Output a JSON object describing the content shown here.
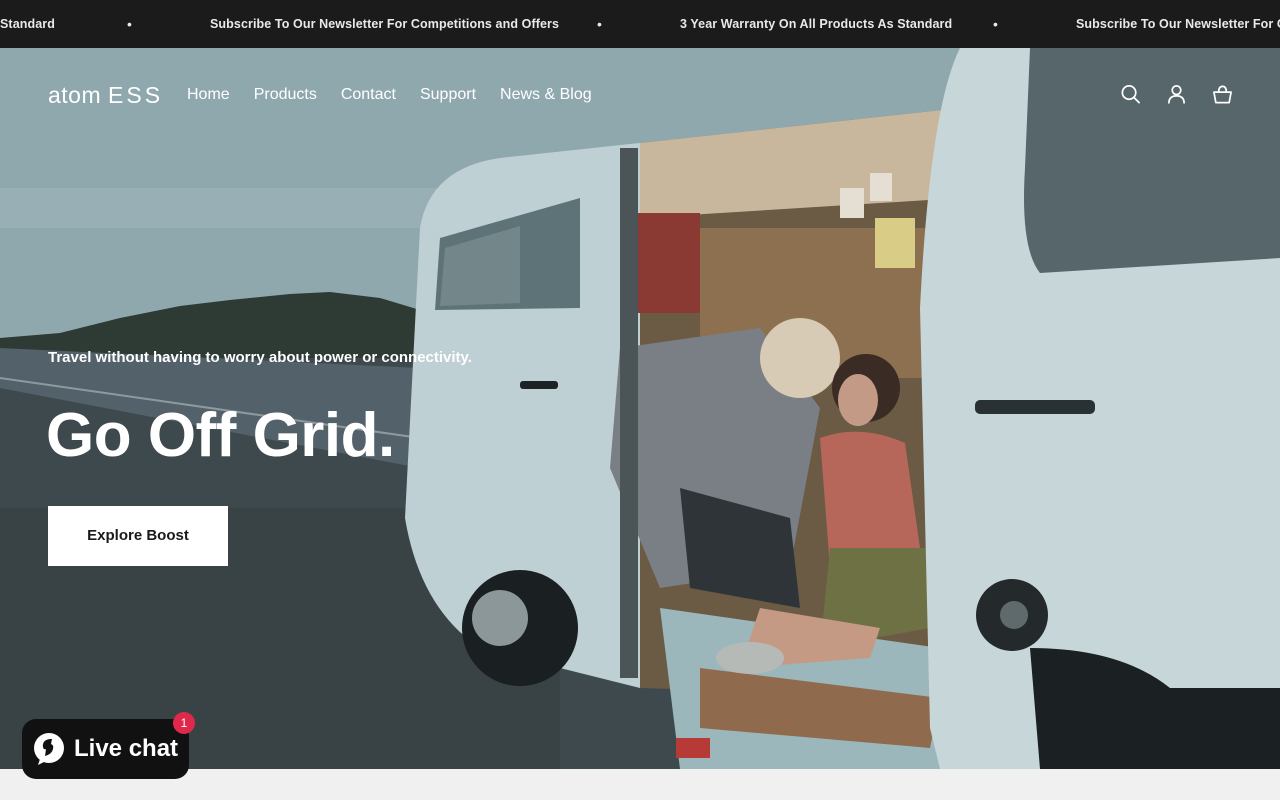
{
  "announcement": {
    "messages": [
      "Standard",
      "Subscribe To Our Newsletter For Competitions and Offers",
      "3 Year Warranty On All Products As Standard",
      "Subscribe To Our Newsletter For Comp"
    ],
    "separator": "•"
  },
  "header": {
    "logo_text": "atom",
    "logo_suffix": "ESS",
    "nav": [
      "Home",
      "Products",
      "Contact",
      "Support",
      "News & Blog"
    ],
    "icons": [
      "search-icon",
      "account-icon",
      "cart-icon"
    ]
  },
  "hero": {
    "subtitle": "Travel without having to worry about power or connectivity.",
    "headline": "Go Off Grid.",
    "cta_label": "Explore Boost"
  },
  "chat": {
    "label": "Live chat",
    "badge_count": "1"
  },
  "colors": {
    "announcement_bg": "#1b1b1b",
    "chat_bg": "#111111",
    "badge": "#e0294a",
    "cta_bg": "#ffffff"
  }
}
